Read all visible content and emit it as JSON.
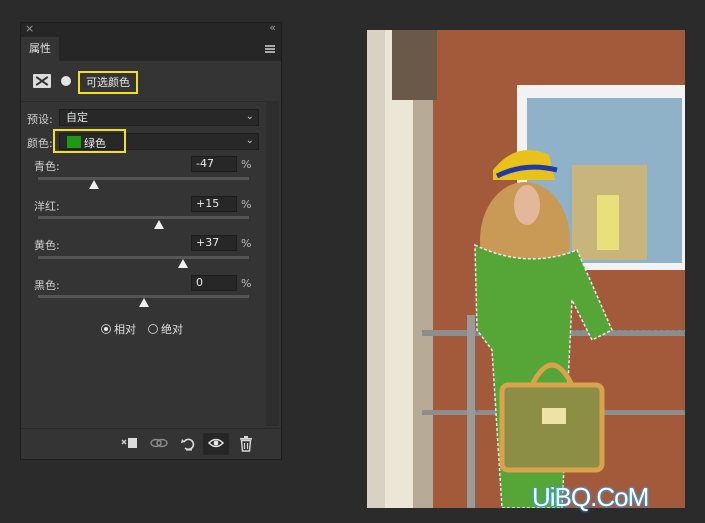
{
  "panel": {
    "close_glyph": "×",
    "collapse_glyph": "«",
    "tab_title": "属性",
    "adjustment_name": "可选颜色",
    "preset_label": "预设:",
    "preset_value": "自定",
    "colors_label": "颜色:",
    "color_value": "绿色",
    "chevron_glyph": "⌄",
    "swatch_color": "#1b9a12",
    "highlight_color": "#f3e11e",
    "sliders": [
      {
        "label": "青色:",
        "value": "-47",
        "unit": "%",
        "amount": -47
      },
      {
        "label": "洋红:",
        "value": "+15",
        "unit": "%",
        "amount": 15
      },
      {
        "label": "黄色:",
        "value": "+37",
        "unit": "%",
        "amount": 37
      },
      {
        "label": "黑色:",
        "value": "0",
        "unit": "%",
        "amount": 0
      }
    ],
    "method_options": [
      {
        "label": "相对",
        "selected": true
      },
      {
        "label": "绝对",
        "selected": false
      }
    ],
    "bottom_icons": [
      "clip-to-layer-icon",
      "view-previous-icon",
      "reset-icon",
      "visibility-eye-icon",
      "trash-icon"
    ]
  },
  "watermark": "UiBQ.CoM"
}
